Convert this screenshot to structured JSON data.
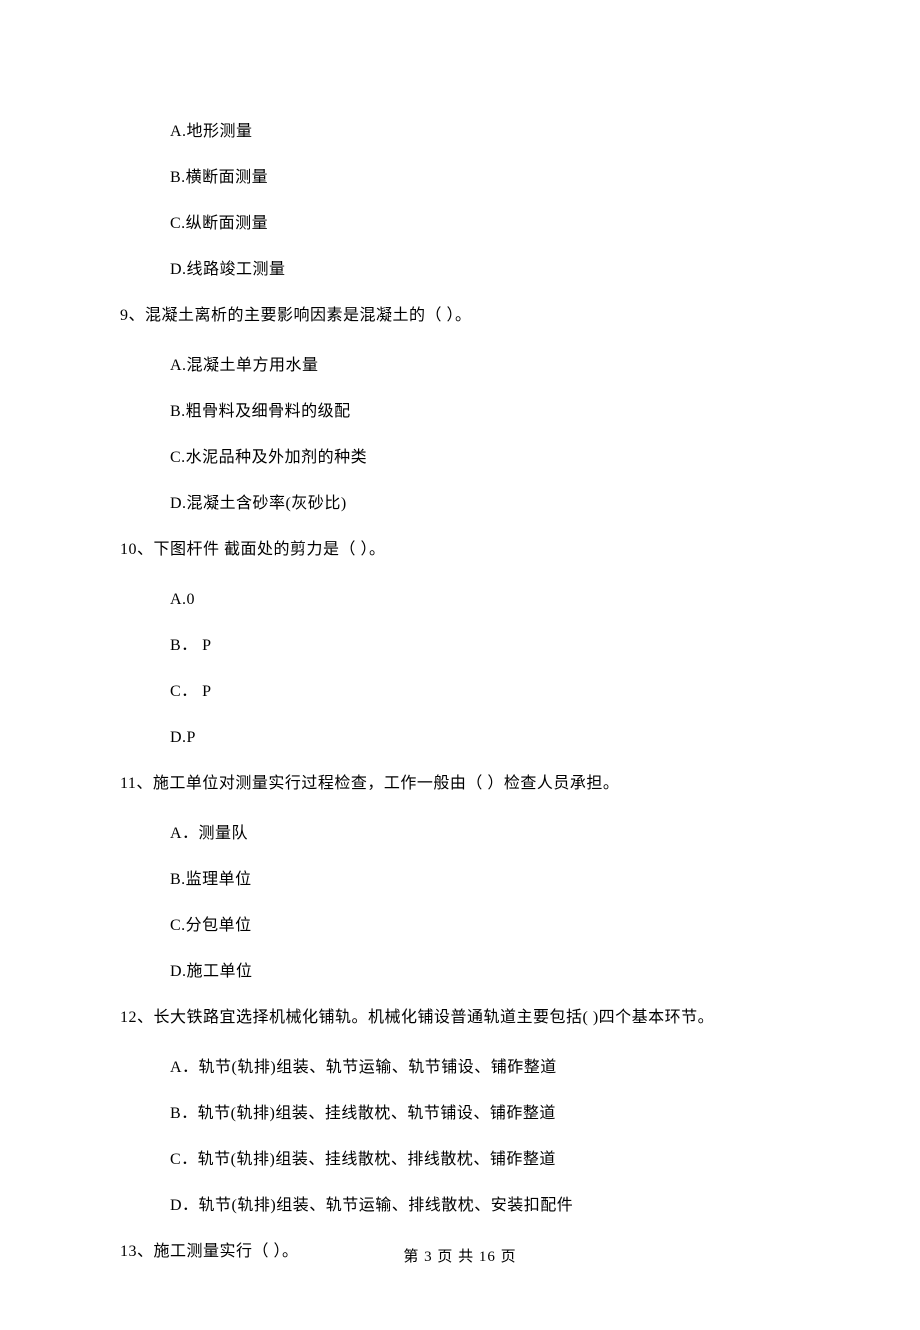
{
  "q8_options": {
    "a": "A.地形测量",
    "b": "B.横断面测量",
    "c": "C.纵断面测量",
    "d": "D.线路竣工测量"
  },
  "q9": {
    "text": "9、混凝土离析的主要影响因素是混凝土的（    ）。",
    "a": "A.混凝土单方用水量",
    "b": "B.粗骨料及细骨料的级配",
    "c": "C.水泥品种及外加剂的种类",
    "d": "D.混凝土含砂率(灰砂比)"
  },
  "q10": {
    "text": "10、下图杆件 截面处的剪力是（    ）。",
    "a": "A.0",
    "b": "B． P",
    "c": "C． P",
    "d": "D.P"
  },
  "q11": {
    "text": "11、施工单位对测量实行过程检查，工作一般由（    ）检查人员承担。",
    "a": "A．测量队",
    "b": "B.监理单位",
    "c": "C.分包单位",
    "d": "D.施工单位"
  },
  "q12": {
    "text": "12、长大铁路宜选择机械化铺轨。机械化铺设普通轨道主要包括(    )四个基本环节。",
    "a": "A．轨节(轨排)组装、轨节运输、轨节铺设、铺砟整道",
    "b": "B．轨节(轨排)组装、挂线散枕、轨节铺设、铺砟整道",
    "c": "C．轨节(轨排)组装、挂线散枕、排线散枕、铺砟整道",
    "d": "D．轨节(轨排)组装、轨节运输、排线散枕、安装扣配件"
  },
  "q13": {
    "text": "13、施工测量实行（    ）。"
  },
  "footer": "第 3 页 共 16 页"
}
